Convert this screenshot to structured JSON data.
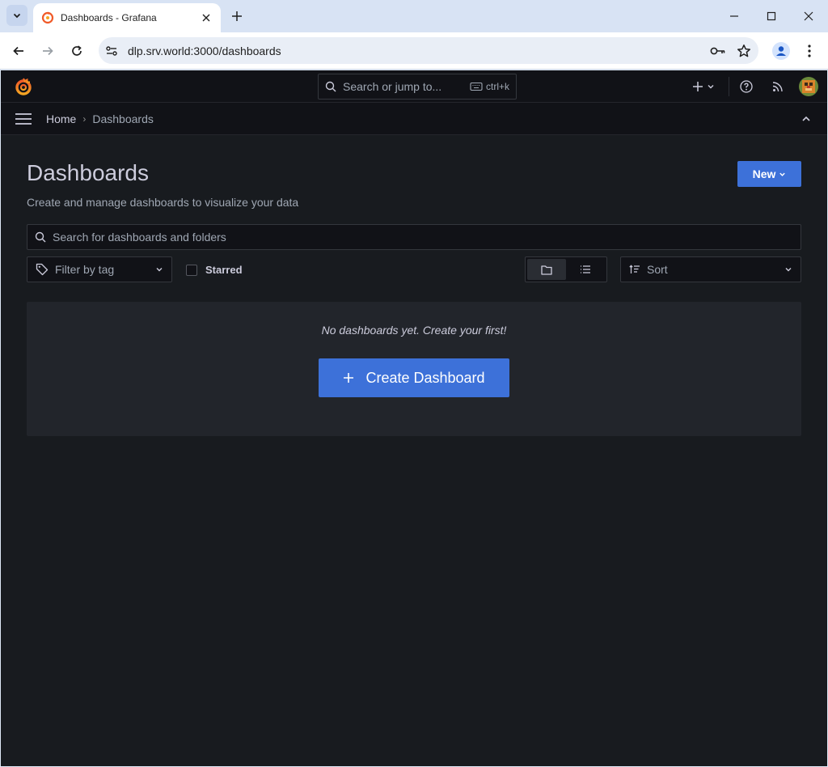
{
  "browser": {
    "tab_title": "Dashboards - Grafana",
    "url": "dlp.srv.world:3000/dashboards"
  },
  "topbar": {
    "search_placeholder": "Search or jump to...",
    "shortcut": "ctrl+k"
  },
  "breadcrumb": {
    "home": "Home",
    "separator": "›",
    "current": "Dashboards"
  },
  "page": {
    "title": "Dashboards",
    "subtitle": "Create and manage dashboards to visualize your data",
    "new_button": "New"
  },
  "filters": {
    "search_placeholder": "Search for dashboards and folders",
    "tag_placeholder": "Filter by tag",
    "starred_label": "Starred",
    "sort_label": "Sort",
    "active_view": "folder-view"
  },
  "empty_state": {
    "message": "No dashboards yet. Create your first!",
    "create_button": "Create Dashboard"
  },
  "colors": {
    "primary": "#3d71d9",
    "background": "#181b1f",
    "topbar": "#111217",
    "panel": "#22252b"
  }
}
